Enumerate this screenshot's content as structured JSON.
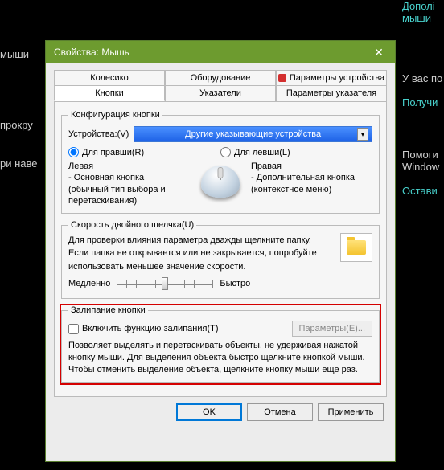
{
  "bg": {
    "t1": "Дополі",
    "t2": "мыши",
    "t3": "мыши",
    "t4": "прокру",
    "t5": "ри наве",
    "r1": "У вас по",
    "r2": "Получи",
    "r3": "Помоги",
    "r4": "Window",
    "r5": "Остави"
  },
  "titlebar": {
    "title": "Свойства: Мышь",
    "close": "✕"
  },
  "tabs": {
    "row1": [
      "Колесико",
      "Оборудование",
      "Параметры устройства"
    ],
    "row2": [
      "Кнопки",
      "Указатели",
      "Параметры указателя"
    ]
  },
  "config": {
    "legend": "Конфигурация кнопки",
    "device_label": "Устройства:(V)",
    "device_value": "Другие указывающие устройства",
    "right_handed": "Для правши(R)",
    "left_handed": "Для левши(L)",
    "left_title": "Левая",
    "left_l1": "- Основная кнопка",
    "left_l2": "(обычный тип выбора и",
    "left_l3": "перетаскивания)",
    "right_title": "Правая",
    "right_l1": "- Дополнительная кнопка",
    "right_l2": "(контекстное меню)"
  },
  "speed": {
    "legend": "Скорость двойного щелчка(U)",
    "desc1": "Для проверки влияния параметра дважды щелкните папку.",
    "desc2": "Если папка не открывается или не закрывается, попробуйте",
    "desc3": "использовать меньшее значение скорости.",
    "slow": "Медленно",
    "fast": "Быстро"
  },
  "sticky": {
    "legend": "Залипание кнопки",
    "check": "Включить функцию залипания(T)",
    "params_btn": "Параметры(E)...",
    "desc": "Позволяет выделять и перетаскивать объекты, не удерживая нажатой кнопку мыши. Для выделения объекта быстро щелкните кнопкой мыши. Чтобы отменить выделение объекта, щелкните кнопку мыши еще раз."
  },
  "buttons": {
    "ok": "OK",
    "cancel": "Отмена",
    "apply": "Применить"
  }
}
